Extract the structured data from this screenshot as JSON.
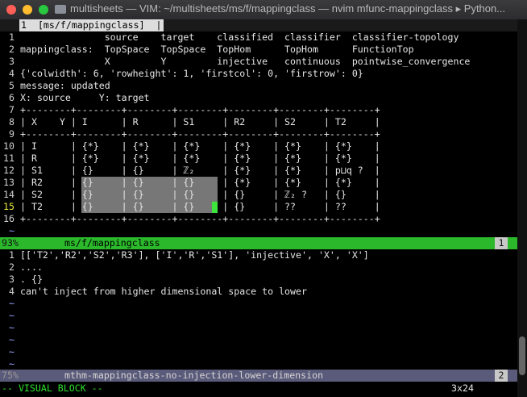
{
  "window": {
    "title": "multisheets — VIM: ~/multisheets/ms/f/mappingclass — nvim mfunc-mappingclass ▸ Python..."
  },
  "tabline": {
    "tab_label": "1  [ms/f/mappingclass]  |"
  },
  "top_pane": {
    "lines": [
      {
        "num": "1",
        "text": "               source    target    classified  classifier  classifier-topology"
      },
      {
        "num": "2",
        "text": "mappingclass:  TopSpace  TopSpace  TopHom      TopHom      FunctionTop"
      },
      {
        "num": "3",
        "text": "               X         Y         injective   continuous  pointwise_convergence"
      },
      {
        "num": "4",
        "text": "{'colwidth': 6, 'rowheight': 1, 'firstcol': 0, 'firstrow': 0}"
      },
      {
        "num": "5",
        "text": "message: updated"
      },
      {
        "num": "6",
        "text": "X: source     Y: target"
      },
      {
        "num": "7",
        "text": "+--------+--------+--------+--------+--------+--------+--------+"
      },
      {
        "num": "8",
        "text": "| X    Y | I      | R      | S1     | R2     | S2     | T2     |"
      },
      {
        "num": "9",
        "text": "+--------+--------+--------+--------+--------+--------+--------+"
      },
      {
        "num": "10",
        "text": "| I      | {*}    | {*}    | {*}    | {*}    | {*}    | {*}    |"
      },
      {
        "num": "11",
        "text": "| R      | {*}    | {*}    | {*}    | {*}    | {*}    | {*}    |"
      },
      {
        "num": "12",
        "text": "| S1     | {}     | {}     | ℤ₂     | {*}    | {*}    | p⊔q ?  |"
      },
      {
        "num": "13",
        "text": "| R2     | {}     | {}     | {}     | {*}    | {*}    | {*}    |"
      },
      {
        "num": "14",
        "text": "| S2     | {}     | {}     | {}     | {}     | ℤ₂ ?   | {}     |"
      },
      {
        "num": "15",
        "text": "| T2     | {}     | {}     | {}     | {}     | ??     | ??     |"
      },
      {
        "num": "16",
        "text": "+--------+--------+--------+--------+--------+--------+--------+"
      },
      {
        "num": "~",
        "text": ""
      }
    ]
  },
  "status_top": {
    "percent": "93%",
    "filename": "ms/f/mappingclass",
    "window_number": "1"
  },
  "bottom_pane": {
    "lines": [
      {
        "num": "1",
        "text": "[['T2','R2','S2','R3'], ['I','R','S1'], 'injective', 'X', 'X']"
      },
      {
        "num": "2",
        "text": "...."
      },
      {
        "num": "3",
        "text": ". {}"
      },
      {
        "num": "4",
        "text": "can't inject from higher dimensional space to lower"
      },
      {
        "num": "~",
        "text": ""
      },
      {
        "num": "~",
        "text": ""
      },
      {
        "num": "~",
        "text": ""
      },
      {
        "num": "~",
        "text": ""
      },
      {
        "num": "~",
        "text": ""
      },
      {
        "num": "~",
        "text": ""
      }
    ]
  },
  "status_bottom": {
    "percent": "75%",
    "filename": "mthm-mappingclass-no-injection-lower-dimension",
    "window_number": "2"
  },
  "mode_line": {
    "mode": "-- VISUAL BLOCK --",
    "selection_size": "3x24"
  },
  "colors": {
    "status_active": "#2bb82b",
    "status_inactive": "#5a5a7a",
    "visual_selection": "#777777",
    "cursor": "#3ee43e",
    "current_line_number": "#e8e83c"
  }
}
